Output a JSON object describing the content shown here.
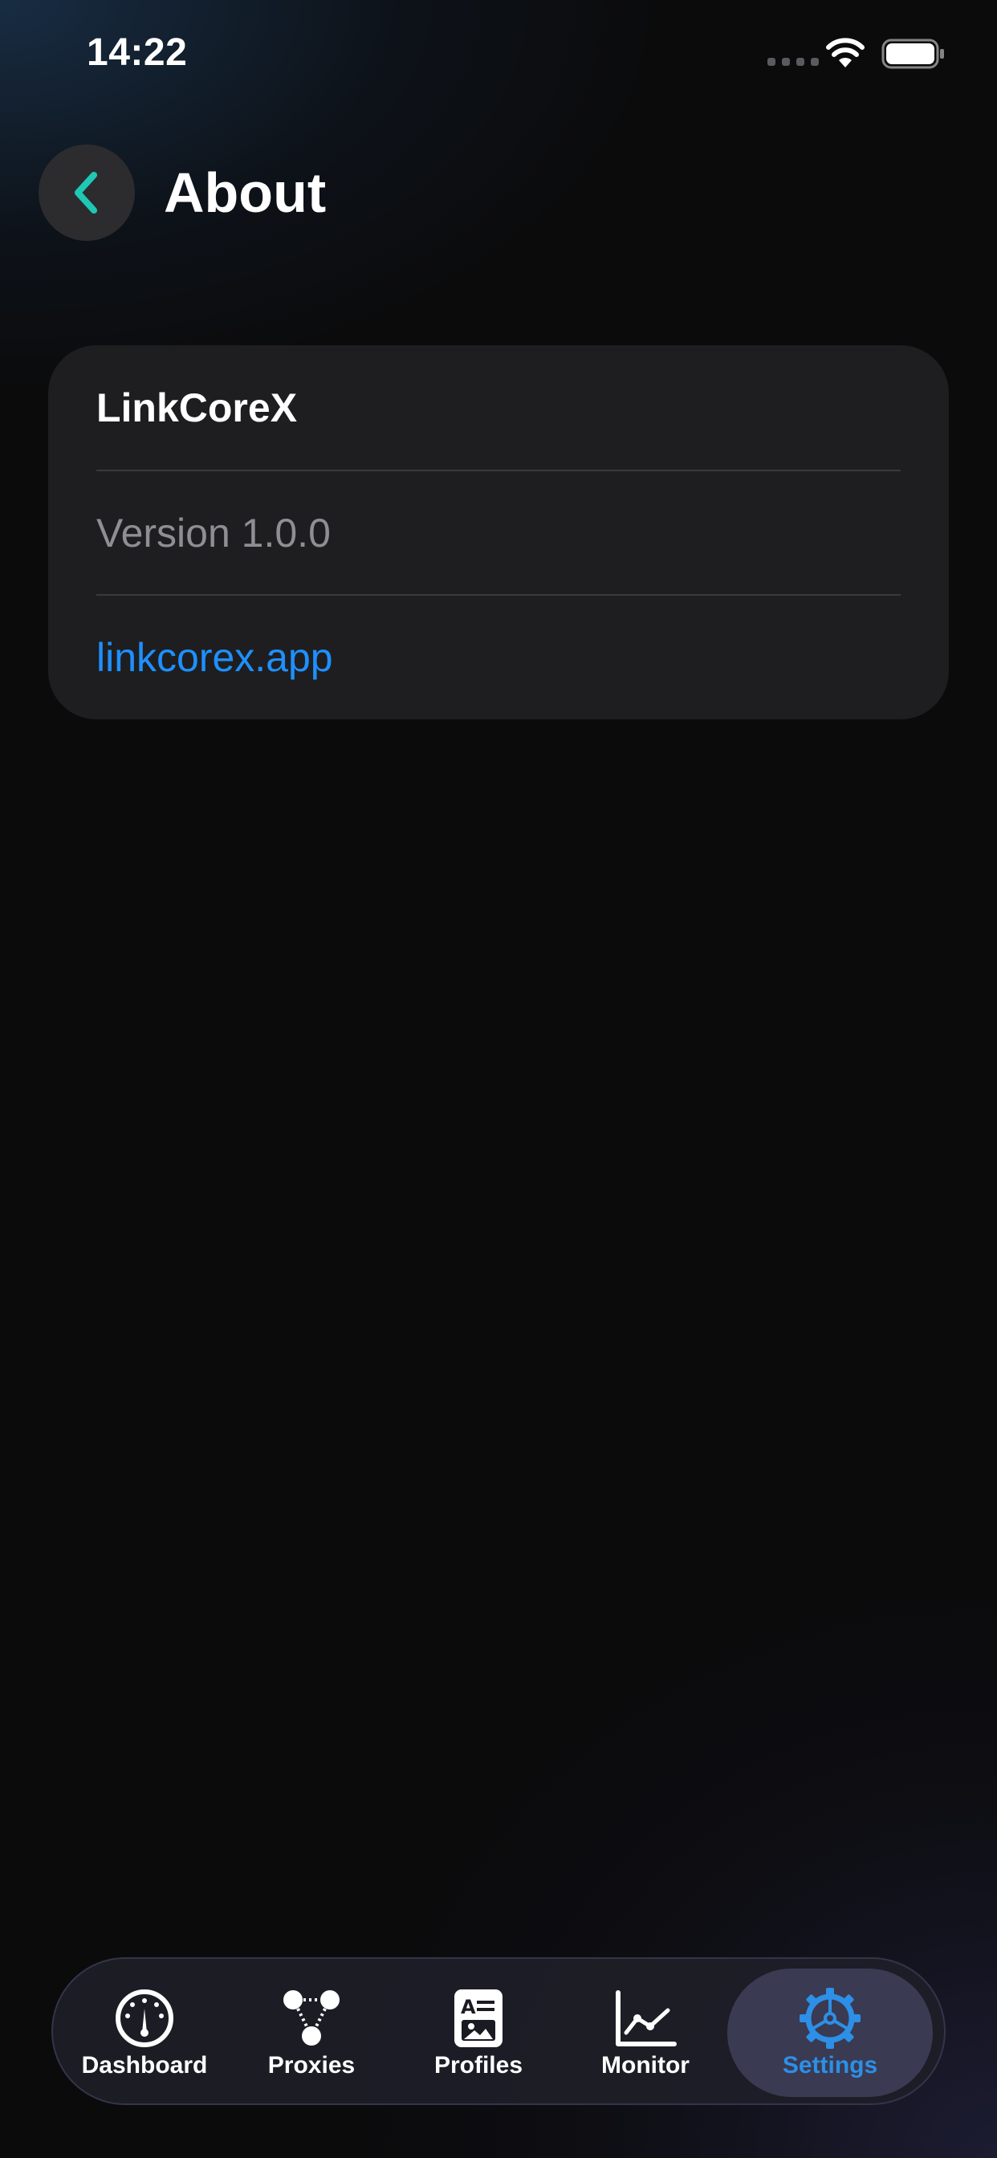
{
  "status_bar": {
    "time": "14:22"
  },
  "header": {
    "back_icon": "chevron-left-icon",
    "title": "About"
  },
  "about_card": {
    "app_name": "LinkCoreX",
    "version": "Version 1.0.0",
    "website": "linkcorex.app"
  },
  "tab_bar": {
    "active": "Settings",
    "items": [
      {
        "label": "Dashboard",
        "icon": "gauge-icon"
      },
      {
        "label": "Proxies",
        "icon": "nodes-icon"
      },
      {
        "label": "Profiles",
        "icon": "profile-document-icon"
      },
      {
        "label": "Monitor",
        "icon": "line-chart-icon"
      },
      {
        "label": "Settings",
        "icon": "gear-icon"
      }
    ]
  },
  "colors": {
    "accent_back": "#1ec8b4",
    "link": "#1e90ff",
    "active_tab": "#2d8fe6",
    "card_bg": "#1e1e20"
  }
}
